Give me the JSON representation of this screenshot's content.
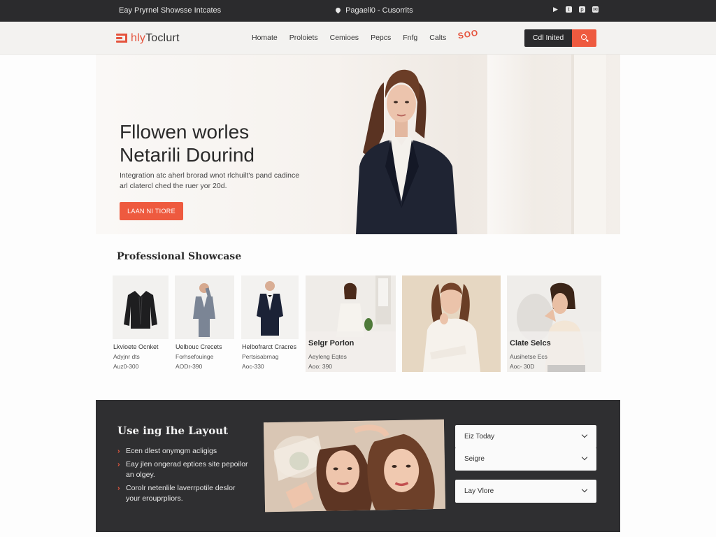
{
  "topbar": {
    "left_text": "Eay Pryrnel Showsse Intcates",
    "center_text": "Pagaeli0 - Cusorrits",
    "social_icons": [
      "play-icon",
      "twitter-icon",
      "pinterest-icon",
      "email-icon"
    ]
  },
  "nav": {
    "logo_prefix": "hly",
    "logo_suffix": "Toclurt",
    "links": [
      "Homate",
      "Proloiets",
      "Cemioes",
      "Pepcs",
      "Fnfg",
      "Calts"
    ],
    "badge": "SOO",
    "cta_label": "Cdl Inited",
    "search_icon": "search-icon",
    "accent_color": "#ee5a3f"
  },
  "hero": {
    "title_line1": "Fllowen worles",
    "title_line2": "Netarili Dourind",
    "subtitle": "Integration atc aherl brorad wnot rlchuilt's pand cadince arl clatercl ched the ruer yor 20d.",
    "button_label": "LAAN NI TIORE"
  },
  "showcase": {
    "title": "Professional Showcase",
    "cards": [
      {
        "title": "Lkvioete Ocnket",
        "line2": "Adyjnr dts",
        "line3": "Auz0-300"
      },
      {
        "title": "Uelbouc Crecets",
        "line2": "Forhsefouinge",
        "line3": "AODr-390"
      },
      {
        "title": "Helbofrarct Cracres",
        "line2": "Pertsisabrnag",
        "line3": "Aoc-330"
      },
      {
        "title": "Selgr Porlon",
        "line2": "Aeyleng Eqtes",
        "line3": "Aoo: 390"
      },
      {
        "title": "",
        "line2": "",
        "line3": ""
      },
      {
        "title": "Clate Selcs",
        "line2": "Ausihetse Ecs",
        "line3": "Aoc- 30D"
      }
    ]
  },
  "layout": {
    "title": "Use ing Ihe Layout",
    "bullets": [
      "Ecen dlest onymgm acligigs",
      "Eay jlen ongerad eptices site pepoilor an olgey.",
      "Corolr netenlile laverrpotile deslor your erouprpliors."
    ],
    "dropdowns": [
      "Eiz Today",
      "Seigre",
      "Lay Vlore"
    ]
  }
}
